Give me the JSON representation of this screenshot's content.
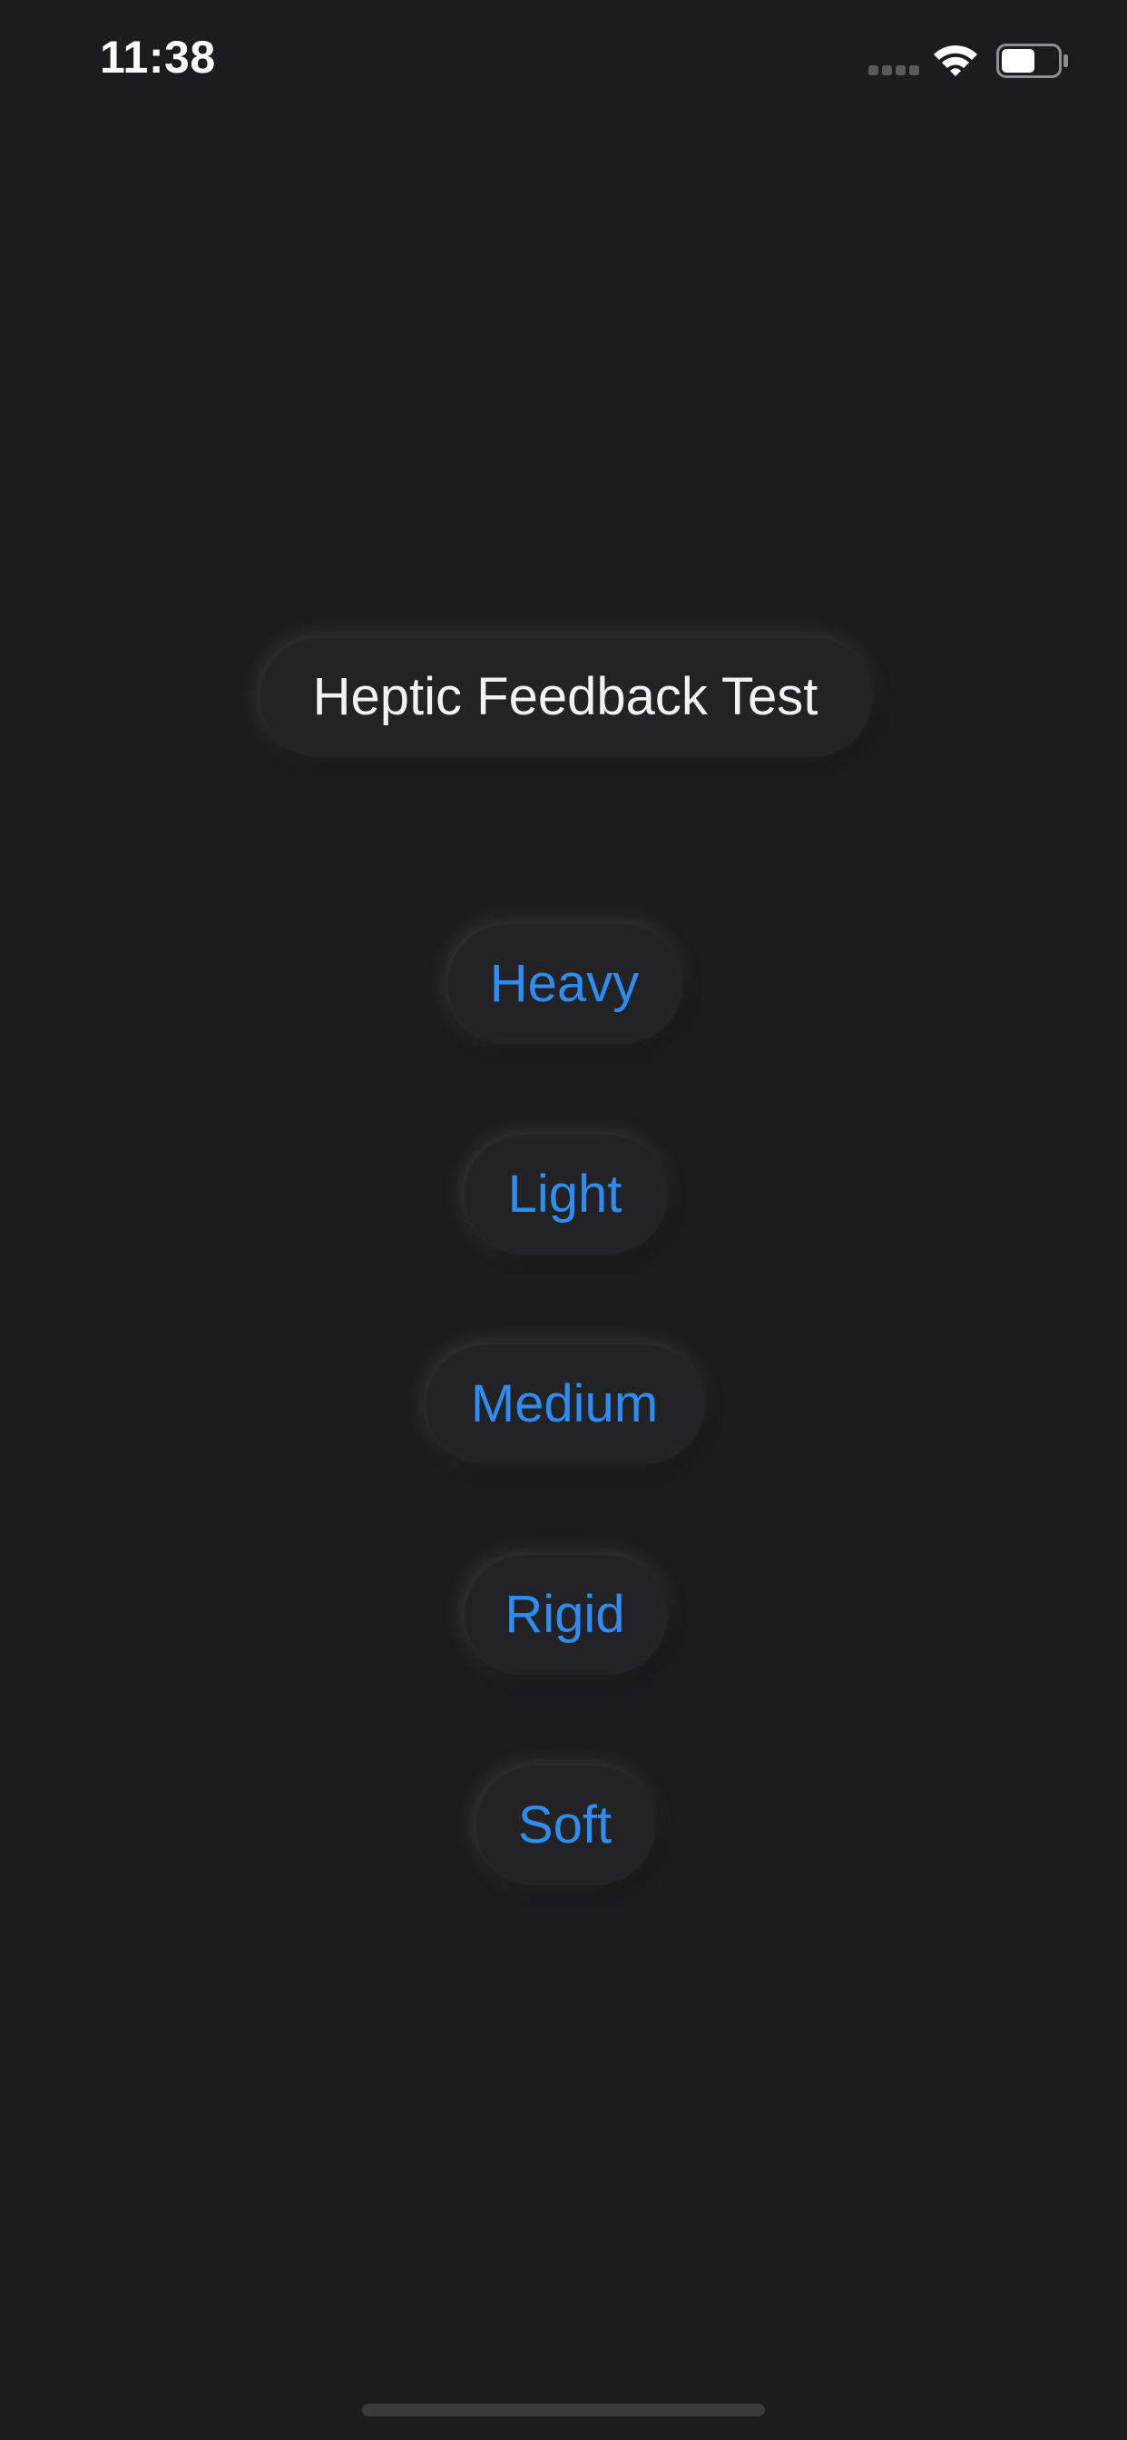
{
  "status_bar": {
    "time": "11:38",
    "icons": [
      "cellular-signal-icon",
      "wifi-icon",
      "battery-icon"
    ],
    "battery_level": 0.6
  },
  "title": "Heptic Feedback Test",
  "buttons": [
    {
      "label": "Heavy"
    },
    {
      "label": "Light"
    },
    {
      "label": "Medium"
    },
    {
      "label": "Rigid"
    },
    {
      "label": "Soft"
    }
  ],
  "colors": {
    "background": "#1c1c1e",
    "pill": "#232326",
    "accent": "#2f8cf2",
    "title_text": "#f2f2f2"
  }
}
